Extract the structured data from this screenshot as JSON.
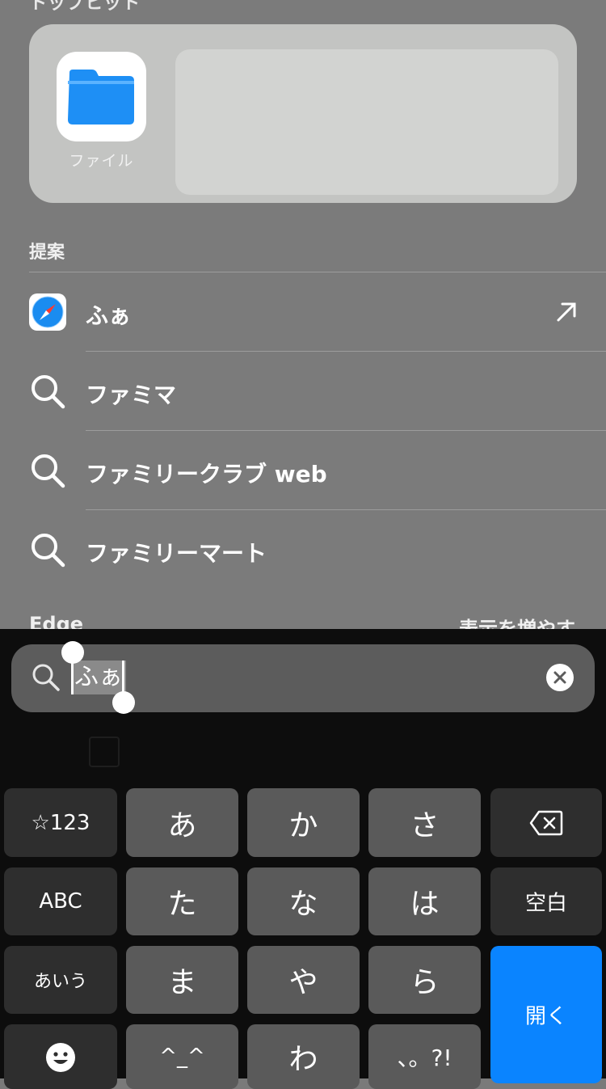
{
  "top_hits": {
    "heading": "トップヒット",
    "app_label": "ファイル"
  },
  "suggestions": {
    "heading": "提案",
    "items": [
      {
        "text": "ふぁ",
        "icon": "safari-icon",
        "has_arrow": true
      },
      {
        "text": "ファミマ",
        "icon": "search-icon"
      },
      {
        "text": "ファミリークラブ web",
        "icon": "search-icon"
      },
      {
        "text": "ファミリーマート",
        "icon": "search-icon"
      }
    ]
  },
  "edge_section": {
    "heading": "Edge",
    "show_more": "表示を増やす"
  },
  "search": {
    "query": "ふぁ"
  },
  "keyboard": {
    "row1": [
      "☆123",
      "あ",
      "か",
      "さ"
    ],
    "row2": [
      "ABC",
      "た",
      "な",
      "は",
      "空白"
    ],
    "row3": [
      "あいう",
      "ま",
      "や",
      "ら"
    ],
    "row4": [
      "^_^",
      "わ",
      "、。?!"
    ],
    "open": "開く"
  },
  "colors": {
    "accent": "#0a84ff",
    "files_blue": "#1e8ff5"
  }
}
